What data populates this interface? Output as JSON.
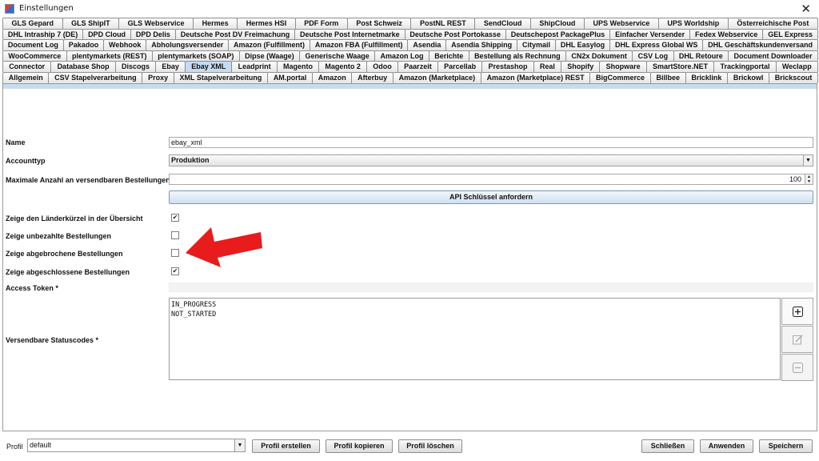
{
  "window": {
    "title": "Einstellungen",
    "close_glyph": "✕"
  },
  "tabs": [
    [
      "GLS Gepard",
      "GLS ShipIT",
      "GLS Webservice",
      "Hermes",
      "Hermes HSI",
      "PDF Form",
      "Post Schweiz",
      "PostNL REST",
      "SendCloud",
      "ShipCloud",
      "UPS Webservice",
      "UPS Worldship",
      "Österreichische Post"
    ],
    [
      "DHL Intraship 7 (DE)",
      "DPD Cloud",
      "DPD Delis",
      "Deutsche Post DV Freimachung",
      "Deutsche Post Internetmarke",
      "Deutsche Post Portokasse",
      "Deutschepost PackagePlus",
      "Einfacher Versender",
      "Fedex Webservice",
      "GEL Express"
    ],
    [
      "Document Log",
      "Pakadoo",
      "Webhook",
      "Abholungsversender",
      "Amazon (Fulfillment)",
      "Amazon FBA (Fulfillment)",
      "Asendia",
      "Asendia Shipping",
      "Citymail",
      "DHL Easylog",
      "DHL Express Global WS",
      "DHL Geschäftskundenversand"
    ],
    [
      "WooCommerce",
      "plentymarkets (REST)",
      "plentymarkets (SOAP)",
      "Dipse (Waage)",
      "Generische Waage",
      "Amazon Log",
      "Berichte",
      "Bestellung als Rechnung",
      "CN2x Dokument",
      "CSV Log",
      "DHL Retoure",
      "Document Downloader"
    ],
    [
      "Connector",
      "Database Shop",
      "Discogs",
      "Ebay",
      "Ebay XML",
      "Leadprint",
      "Magento",
      "Magento 2",
      "Odoo",
      "Paarzeit",
      "Parcellab",
      "Prestashop",
      "Real",
      "Shopify",
      "Shopware",
      "SmartStore.NET",
      "Trackingportal",
      "Weclapp"
    ],
    [
      "Allgemein",
      "CSV Stapelverarbeitung",
      "Proxy",
      "XML Stapelverarbeitung",
      "AM.portal",
      "Amazon",
      "Afterbuy",
      "Amazon (Marketplace)",
      "Amazon (Marketplace) REST",
      "BigCommerce",
      "Billbee",
      "Bricklink",
      "Brickowl",
      "Brickscout"
    ]
  ],
  "active_tab": "Ebay XML",
  "form": {
    "name_label": "Name",
    "name_value": "ebay_xml",
    "accounttype_label": "Accounttyp",
    "accounttype_value": "Produktion",
    "max_orders_label": "Maximale Anzahl an versendbaren Bestellungen",
    "max_orders_value": "100",
    "api_key_button": "API Schlüssel anfordern",
    "cb_country_label": "Zeige den Länderkürzel in der Übersicht",
    "cb_unpaid_label": "Zeige unbezahlte Bestellungen",
    "cb_cancelled_label": "Zeige abgebrochene Bestellungen",
    "cb_completed_label": "Zeige abgeschlossene Bestellungen",
    "cb_country_checked": true,
    "cb_unpaid_checked": false,
    "cb_cancelled_checked": false,
    "cb_completed_checked": true,
    "checkmark_glyph": "✔",
    "access_token_label": "Access Token *",
    "status_codes_label": "Versendbare Statuscodes *",
    "status_codes": [
      "IN_PROGRESS",
      "NOT_STARTED"
    ]
  },
  "footer": {
    "profile_label": "Profil",
    "profile_value": "default",
    "create_button": "Profil erstellen",
    "copy_button": "Profil kopieren",
    "delete_button": "Profil löschen",
    "close_button": "Schließen",
    "apply_button": "Anwenden",
    "save_button": "Speichern"
  },
  "colors": {
    "annotation_arrow": "#e81c1c",
    "active_tab": "#c5dcf2",
    "panel_header": "#c8dcef"
  },
  "icons": [
    "app-icon",
    "close-icon",
    "chevron-down-icon",
    "add-icon",
    "edit-icon",
    "remove-icon",
    "annotation-arrow-icon"
  ]
}
